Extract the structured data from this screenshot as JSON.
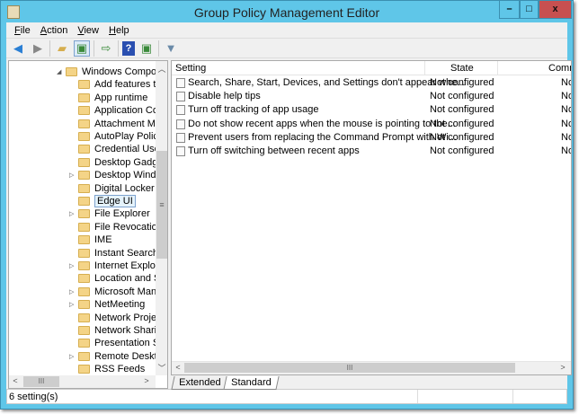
{
  "window": {
    "title": "Group Policy Management Editor",
    "minimize": "–",
    "maximize": "□",
    "close": "x"
  },
  "menu": [
    {
      "key": "F",
      "rest": "ile"
    },
    {
      "key": "A",
      "rest": "ction"
    },
    {
      "key": "V",
      "rest": "iew"
    },
    {
      "key": "H",
      "rest": "elp"
    }
  ],
  "tree": {
    "root": "Windows Components",
    "items": [
      {
        "label": "Add features to Windows",
        "expandable": false
      },
      {
        "label": "App runtime",
        "expandable": false
      },
      {
        "label": "Application Compatibility",
        "expandable": false
      },
      {
        "label": "Attachment Manager",
        "expandable": false
      },
      {
        "label": "AutoPlay Policies",
        "expandable": false
      },
      {
        "label": "Credential User Interface",
        "expandable": false
      },
      {
        "label": "Desktop Gadgets",
        "expandable": false
      },
      {
        "label": "Desktop Window Manager",
        "expandable": true
      },
      {
        "label": "Digital Locker",
        "expandable": false
      },
      {
        "label": "Edge UI",
        "expandable": false,
        "selected": true
      },
      {
        "label": "File Explorer",
        "expandable": true
      },
      {
        "label": "File Revocation",
        "expandable": false
      },
      {
        "label": "IME",
        "expandable": false
      },
      {
        "label": "Instant Search",
        "expandable": false
      },
      {
        "label": "Internet Explorer",
        "expandable": true
      },
      {
        "label": "Location and Sensors",
        "expandable": false
      },
      {
        "label": "Microsoft Management Console",
        "expandable": true
      },
      {
        "label": "NetMeeting",
        "expandable": true
      },
      {
        "label": "Network Projector",
        "expandable": false
      },
      {
        "label": "Network Sharing",
        "expandable": false
      },
      {
        "label": "Presentation Settings",
        "expandable": false
      },
      {
        "label": "Remote Desktop Services",
        "expandable": true
      },
      {
        "label": "RSS Feeds",
        "expandable": false
      }
    ]
  },
  "table": {
    "columns": [
      "Setting",
      "State",
      "Comment"
    ],
    "rows": [
      {
        "setting": "Search, Share, Start, Devices, and Settings don't appear whe...",
        "state": "Not configured",
        "comment": "No"
      },
      {
        "setting": "Disable help tips",
        "state": "Not configured",
        "comment": "No"
      },
      {
        "setting": "Turn off tracking of app usage",
        "state": "Not configured",
        "comment": "No"
      },
      {
        "setting": "Do not show recent apps when the mouse is pointing to the...",
        "state": "Not configured",
        "comment": "No"
      },
      {
        "setting": "Prevent users from replacing the Command Prompt with Wi...",
        "state": "Not configured",
        "comment": "No"
      },
      {
        "setting": "Turn off switching between recent apps",
        "state": "Not configured",
        "comment": "No"
      }
    ]
  },
  "tabs": [
    "Extended",
    "Standard"
  ],
  "status": "6 setting(s)",
  "colors": {
    "frame": "#5fc6e8",
    "close": "#c75050"
  }
}
